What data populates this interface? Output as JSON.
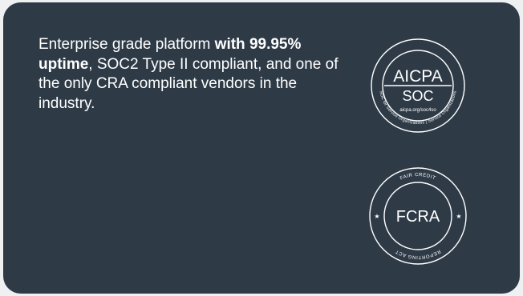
{
  "marketing": {
    "text_before": "Enterprise grade platform ",
    "text_bold": "with 99.95% uptime",
    "text_after": ", SOC2 Type II compliant, and one of the only CRA compliant vendors in the industry."
  },
  "badges": {
    "aicpa": {
      "top_label": "AICPA",
      "bottom_label": "SOC",
      "url": "aicpa.org/soc4so",
      "ring_text": "SOC for Service Organizations | Service Organizations"
    },
    "fcra": {
      "center_label": "FCRA",
      "top_arc": "FAIR CREDIT",
      "bottom_arc": "REPORTING ACT",
      "star": "★"
    }
  },
  "colors": {
    "card_background": "#2e3b47",
    "text": "#ffffff",
    "page_background": "#eef0f2"
  }
}
